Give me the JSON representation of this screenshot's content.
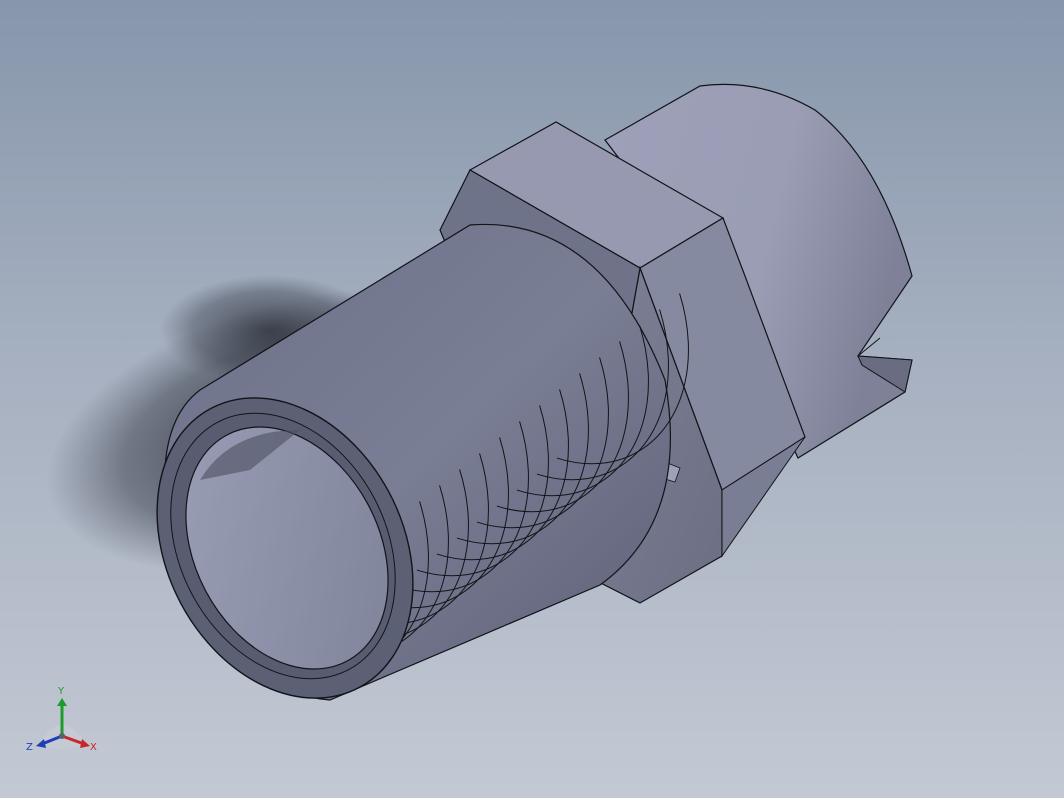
{
  "viewport": {
    "background_top": "#8796ac",
    "background_bottom": "#c3c9d4"
  },
  "model": {
    "part_color": "#8a8ea8",
    "edge_color": "#111418",
    "features": [
      "threaded-shank",
      "hex-flange",
      "cylindrical-body",
      "slot"
    ]
  },
  "triad": {
    "x_label": "X",
    "y_label": "Y",
    "z_label": "Z",
    "x_color": "#c8262a",
    "y_color": "#1e9b2c",
    "z_color": "#1f3fb5"
  }
}
